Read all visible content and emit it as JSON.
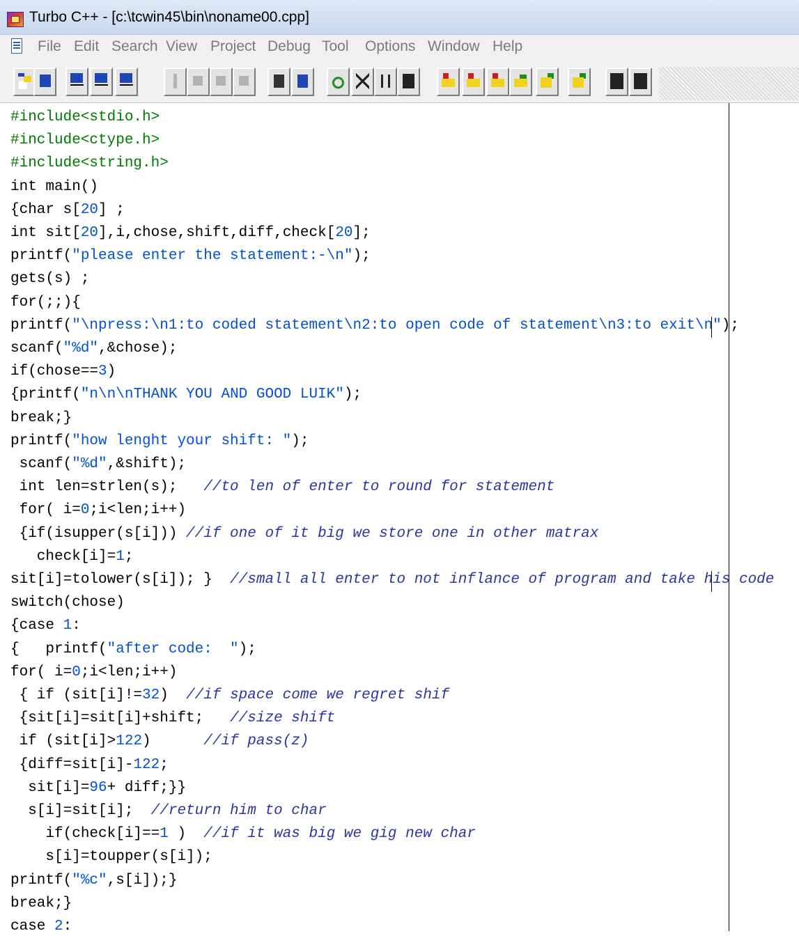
{
  "window": {
    "title": "Turbo C++ - [c:\\tcwin45\\bin\\noname00.cpp]",
    "app_icon": "turbo-cpp-app-icon"
  },
  "menu": [
    "File",
    "Edit",
    "Search",
    "View",
    "Project",
    "Debug",
    "Tool",
    "Options",
    "Window",
    "Help"
  ],
  "toolbar": {
    "icons": [
      "open-file-icon",
      "save-file-icon",
      "compile-icon",
      "make-icon",
      "build-all-icon",
      "lightning-icon",
      "step-over-icon",
      "trace-into-icon",
      "run-icon",
      "inspect-icon",
      "watch-icon",
      "undo-icon",
      "cut-icon",
      "copy-icon",
      "paste-icon",
      "search-icon",
      "replace-icon",
      "search-again-icon",
      "find-in-files-icon",
      "previous-message-icon",
      "next-message-icon",
      "tile-icon",
      "cascade-icon"
    ],
    "accent_colors": {
      "icon_blue": "#1e46b4",
      "icon_yellow": "#f2d21e",
      "icon_green": "#1e8c1e",
      "icon_red": "#c81e1e"
    }
  },
  "colors": {
    "preprocessor": "#007a00",
    "string": "#0050d8",
    "number": "#0050d8",
    "comment": "#2a36a0",
    "code": "#000000"
  },
  "editor": {
    "lines": [
      [
        {
          "k": "pp",
          "t": "#include<stdio.h>"
        }
      ],
      [
        {
          "k": "pp",
          "t": "#include<ctype.h>"
        }
      ],
      [
        {
          "k": "pp",
          "t": "#include<string.h>"
        }
      ],
      [
        {
          "k": "",
          "t": "int main()"
        }
      ],
      [
        {
          "k": "",
          "t": "{char s["
        },
        {
          "k": "num",
          "t": "20"
        },
        {
          "k": "",
          "t": "] ;"
        }
      ],
      [
        {
          "k": "",
          "t": "int sit["
        },
        {
          "k": "num",
          "t": "20"
        },
        {
          "k": "",
          "t": "],i,chose,shift,diff,check["
        },
        {
          "k": "num",
          "t": "20"
        },
        {
          "k": "",
          "t": "];"
        }
      ],
      [
        {
          "k": "",
          "t": "printf("
        },
        {
          "k": "str",
          "t": "\"please enter the statement:-\\n\""
        },
        {
          "k": "",
          "t": ");"
        }
      ],
      [
        {
          "k": "",
          "t": "gets(s) ;"
        }
      ],
      [
        {
          "k": "",
          "t": "for(;;){"
        }
      ],
      [
        {
          "k": "",
          "t": "printf("
        },
        {
          "k": "str",
          "t": "\"\\npress:\\n1:to coded statement\\n2:to open code of statement\\n3:to exit\\n\""
        },
        {
          "k": "",
          "t": ");"
        }
      ],
      [
        {
          "k": "",
          "t": "scanf("
        },
        {
          "k": "str",
          "t": "\"%d\""
        },
        {
          "k": "",
          "t": ",&chose);"
        }
      ],
      [
        {
          "k": "",
          "t": "if(chose=="
        },
        {
          "k": "num",
          "t": "3"
        },
        {
          "k": "",
          "t": ")"
        }
      ],
      [
        {
          "k": "",
          "t": "{printf("
        },
        {
          "k": "str",
          "t": "\"n\\n\\nTHANK YOU AND GOOD LUIK\""
        },
        {
          "k": "",
          "t": ");"
        }
      ],
      [
        {
          "k": "",
          "t": "break;}"
        }
      ],
      [
        {
          "k": "",
          "t": "printf("
        },
        {
          "k": "str",
          "t": "\"how lenght your shift: \""
        },
        {
          "k": "",
          "t": ");"
        }
      ],
      [
        {
          "k": "",
          "t": " scanf("
        },
        {
          "k": "str",
          "t": "\"%d\""
        },
        {
          "k": "",
          "t": ",&shift);"
        }
      ],
      [
        {
          "k": "",
          "t": " int len=strlen(s);   "
        },
        {
          "k": "cm",
          "t": "//to len of enter to round for statement"
        }
      ],
      [
        {
          "k": "",
          "t": " for( i="
        },
        {
          "k": "num",
          "t": "0"
        },
        {
          "k": "",
          "t": ";i<len;i++)"
        }
      ],
      [
        {
          "k": "",
          "t": " {if(isupper(s[i])) "
        },
        {
          "k": "cm",
          "t": "//if one of it big we store one in other matrax"
        }
      ],
      [
        {
          "k": "",
          "t": "   check[i]="
        },
        {
          "k": "num",
          "t": "1"
        },
        {
          "k": "",
          "t": ";"
        }
      ],
      [
        {
          "k": "",
          "t": "sit[i]=tolower(s[i]); }  "
        },
        {
          "k": "cm",
          "t": "//small all enter to not inflance of program and take his code"
        }
      ],
      [
        {
          "k": "",
          "t": "switch(chose)"
        }
      ],
      [
        {
          "k": "",
          "t": "{case "
        },
        {
          "k": "num",
          "t": "1"
        },
        {
          "k": "",
          "t": ":"
        }
      ],
      [
        {
          "k": "",
          "t": "{   printf("
        },
        {
          "k": "str",
          "t": "\"after code:  \""
        },
        {
          "k": "",
          "t": ");"
        }
      ],
      [
        {
          "k": "",
          "t": "for( i="
        },
        {
          "k": "num",
          "t": "0"
        },
        {
          "k": "",
          "t": ";i<len;i++)"
        }
      ],
      [
        {
          "k": "",
          "t": " { if (sit[i]!="
        },
        {
          "k": "num",
          "t": "32"
        },
        {
          "k": "",
          "t": ")  "
        },
        {
          "k": "cm",
          "t": "//if space come we regret shif"
        }
      ],
      [
        {
          "k": "",
          "t": " {sit[i]=sit[i]+shift;   "
        },
        {
          "k": "cm",
          "t": "//size shift"
        }
      ],
      [
        {
          "k": "",
          "t": " if (sit[i]>"
        },
        {
          "k": "num",
          "t": "122"
        },
        {
          "k": "",
          "t": ")      "
        },
        {
          "k": "cm",
          "t": "//if pass(z)"
        }
      ],
      [
        {
          "k": "",
          "t": " {diff=sit[i]-"
        },
        {
          "k": "num",
          "t": "122"
        },
        {
          "k": "",
          "t": ";"
        }
      ],
      [
        {
          "k": "",
          "t": "  sit[i]="
        },
        {
          "k": "num",
          "t": "96"
        },
        {
          "k": "",
          "t": "+ diff;}}"
        }
      ],
      [
        {
          "k": "",
          "t": "  s[i]=sit[i];  "
        },
        {
          "k": "cm",
          "t": "//return him to char"
        }
      ],
      [
        {
          "k": "",
          "t": "    if(check[i]=="
        },
        {
          "k": "num",
          "t": "1"
        },
        {
          "k": "",
          "t": " )  "
        },
        {
          "k": "cm",
          "t": "//if it was big we gig new char"
        }
      ],
      [
        {
          "k": "",
          "t": "    s[i]=toupper(s[i]);"
        }
      ],
      [
        {
          "k": "",
          "t": "printf("
        },
        {
          "k": "str",
          "t": "\"%c\""
        },
        {
          "k": "",
          "t": ",s[i]);}"
        }
      ],
      [
        {
          "k": "",
          "t": "break;}"
        }
      ],
      [
        {
          "k": "",
          "t": "case "
        },
        {
          "k": "num",
          "t": "2"
        },
        {
          "k": "",
          "t": ":"
        }
      ]
    ]
  }
}
